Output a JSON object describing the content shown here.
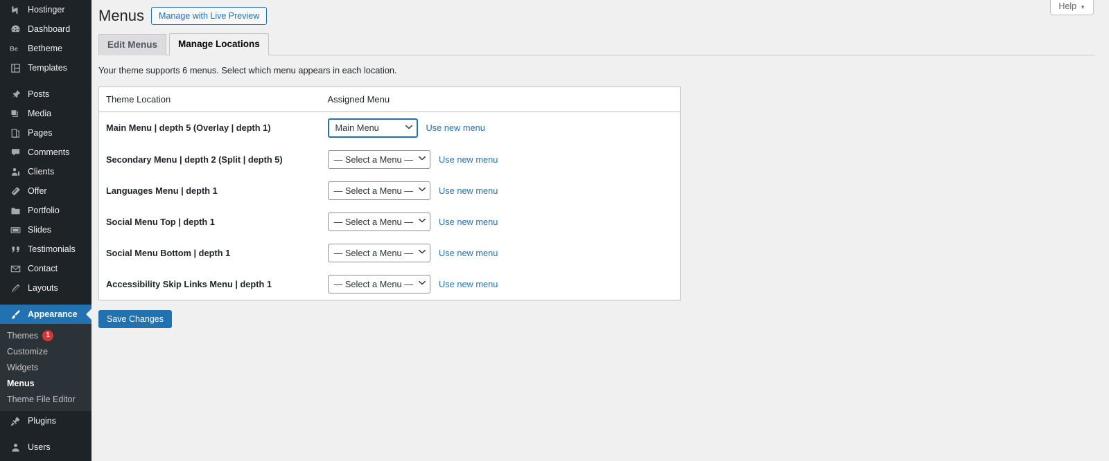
{
  "sidebar": {
    "items": [
      {
        "label": "Hostinger",
        "icon": "hostinger-icon"
      },
      {
        "label": "Dashboard",
        "icon": "dashboard-icon"
      },
      {
        "label": "Betheme",
        "icon": "betheme-icon"
      },
      {
        "label": "Templates",
        "icon": "templates-icon"
      },
      {
        "label": "Posts",
        "icon": "pin-icon"
      },
      {
        "label": "Media",
        "icon": "media-icon"
      },
      {
        "label": "Pages",
        "icon": "pages-icon"
      },
      {
        "label": "Comments",
        "icon": "comments-icon"
      },
      {
        "label": "Clients",
        "icon": "clients-icon"
      },
      {
        "label": "Offer",
        "icon": "offer-icon"
      },
      {
        "label": "Portfolio",
        "icon": "portfolio-icon"
      },
      {
        "label": "Slides",
        "icon": "slides-icon"
      },
      {
        "label": "Testimonials",
        "icon": "quote-icon"
      },
      {
        "label": "Contact",
        "icon": "envelope-icon"
      },
      {
        "label": "Layouts",
        "icon": "pencil-icon"
      },
      {
        "label": "Appearance",
        "icon": "brush-icon"
      },
      {
        "label": "Plugins",
        "icon": "plug-icon"
      },
      {
        "label": "Users",
        "icon": "user-icon"
      }
    ],
    "active_item": "Appearance",
    "submenu": [
      {
        "label": "Themes",
        "badge": "1"
      },
      {
        "label": "Customize",
        "badge": ""
      },
      {
        "label": "Widgets",
        "badge": ""
      },
      {
        "label": "Menus",
        "badge": ""
      },
      {
        "label": "Theme File Editor",
        "badge": ""
      }
    ],
    "submenu_active": "Menus"
  },
  "header": {
    "help_label": "Help",
    "help_caret": "▼",
    "page_title": "Menus",
    "live_preview_label": "Manage with Live Preview"
  },
  "tabs": [
    {
      "label": "Edit Menus",
      "active": false
    },
    {
      "label": "Manage Locations",
      "active": true
    }
  ],
  "description": "Your theme supports 6 menus. Select which menu appears in each location.",
  "table": {
    "columns": [
      "Theme Location",
      "Assigned Menu"
    ],
    "rows": [
      {
        "location": "Main Menu | depth 5 (Overlay | depth 1)",
        "selected": "Main Menu",
        "focused": true,
        "link": "Use new menu"
      },
      {
        "location": "Secondary Menu | depth 2 (Split | depth 5)",
        "selected": "— Select a Menu —",
        "focused": false,
        "link": "Use new menu"
      },
      {
        "location": "Languages Menu | depth 1",
        "selected": "— Select a Menu —",
        "focused": false,
        "link": "Use new menu"
      },
      {
        "location": "Social Menu Top | depth 1",
        "selected": "— Select a Menu —",
        "focused": false,
        "link": "Use new menu"
      },
      {
        "location": "Social Menu Bottom | depth 1",
        "selected": "— Select a Menu —",
        "focused": false,
        "link": "Use new menu"
      },
      {
        "location": "Accessibility Skip Links Menu | depth 1",
        "selected": "— Select a Menu —",
        "focused": false,
        "link": "Use new menu"
      }
    ]
  },
  "save_label": "Save Changes",
  "colors": {
    "accent": "#2271b1",
    "sidebar_bg": "#1d2327",
    "submenu_bg": "#2c3338",
    "content_bg": "#f0f0f1",
    "badge": "#d63638"
  }
}
